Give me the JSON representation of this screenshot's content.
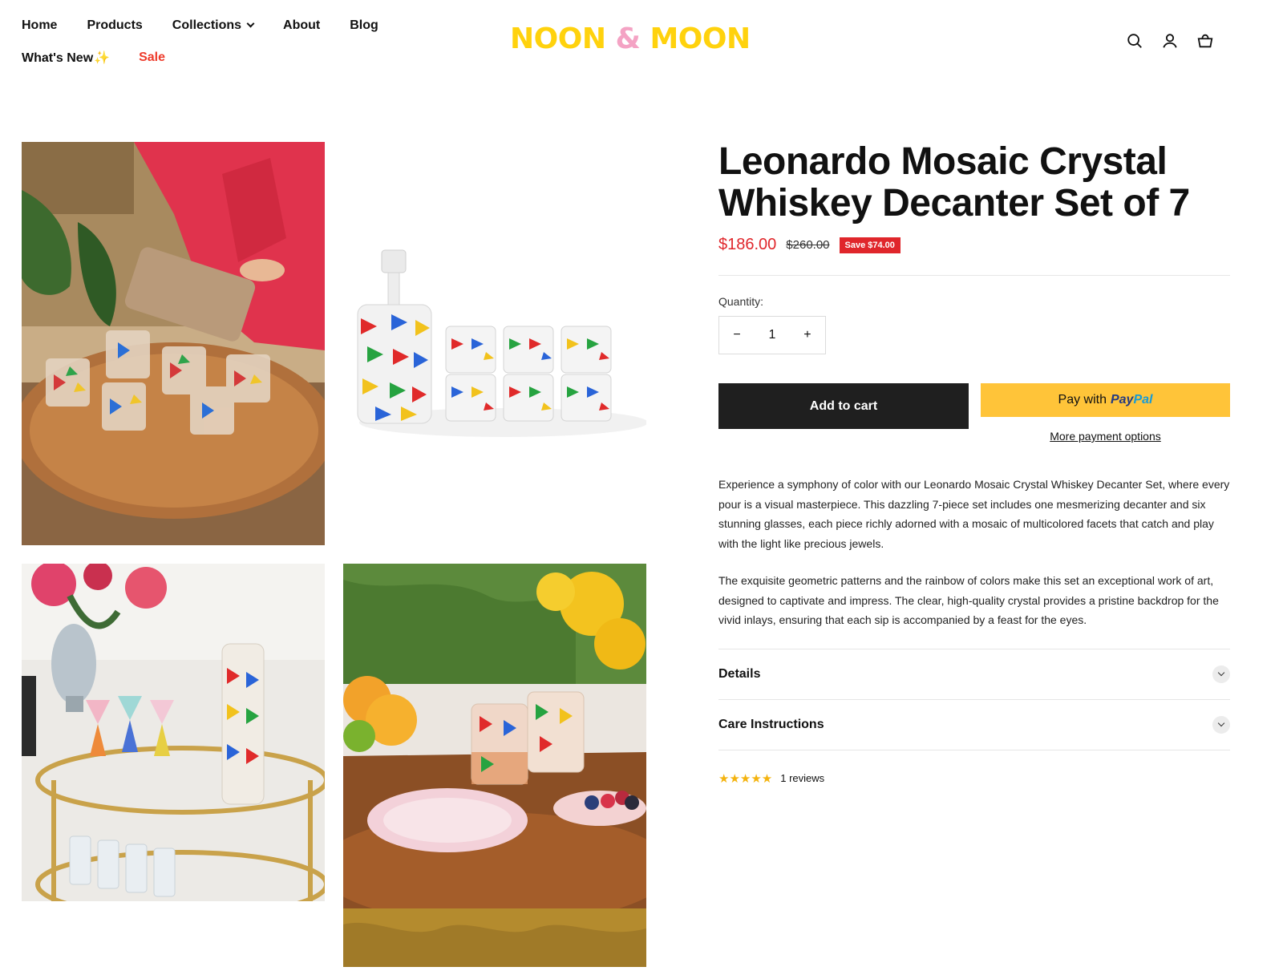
{
  "nav": {
    "row1": [
      {
        "label": "Home"
      },
      {
        "label": "Products"
      },
      {
        "label": "Collections",
        "has_dropdown": true
      },
      {
        "label": "About"
      },
      {
        "label": "Blog"
      }
    ],
    "whats_new": "What's New",
    "sparkle": "✨",
    "sale": "Sale"
  },
  "logo": {
    "word1": "NOON",
    "amp": "&",
    "word2": "MOON"
  },
  "header_icons": [
    "search-icon",
    "account-icon",
    "cart-icon"
  ],
  "product": {
    "title": "Leonardo Mosaic Crystal Whiskey Decanter Set of 7",
    "price": "$186.00",
    "compare_price": "$260.00",
    "save_badge": "Save $74.00",
    "quantity_label": "Quantity:",
    "quantity": "1",
    "minus": "−",
    "plus": "+",
    "add_to_cart": "Add to cart",
    "paypal_prefix": "Pay with",
    "paypal_brand_1": "Pay",
    "paypal_brand_2": "Pal",
    "more_payment": "More payment options",
    "description": [
      "Experience a symphony of color with our Leonardo Mosaic Crystal Whiskey Decanter Set, where every pour is a visual masterpiece. This dazzling 7-piece set includes one mesmerizing decanter and six stunning glasses, each piece richly adorned with a mosaic of multicolored facets that catch and play with the light like precious jewels.",
      "The exquisite geometric patterns and the rainbow of colors make this set an exceptional work of art, designed to captivate and impress. The clear, high-quality crystal provides a pristine backdrop for the vivid inlays, ensuring that each sip is accompanied by a feast for the eyes."
    ],
    "accordions": [
      {
        "title": "Details"
      },
      {
        "title": "Care Instructions"
      }
    ],
    "rating": 5,
    "stars": "★★★★★",
    "reviews_text": "1 reviews"
  },
  "colors": {
    "logo_yellow": "#ffd20d",
    "logo_pink": "#f4a3c4",
    "sale_red": "#ee3b2b",
    "price_red": "#e0262b",
    "paypal_yellow": "#ffc439",
    "cart_button": "#1f1f1f"
  }
}
